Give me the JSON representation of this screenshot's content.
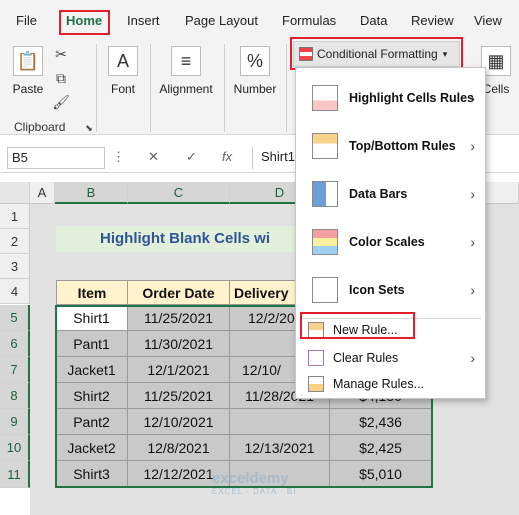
{
  "ribbon_tabs": [
    "File",
    "Home",
    "Insert",
    "Page Layout",
    "Formulas",
    "Data",
    "Review",
    "View"
  ],
  "ribbon": {
    "paste_label": "Paste",
    "clipboard_label": "Clipboard",
    "font_label": "Font",
    "alignment_label": "Alignment",
    "number_label": "Number",
    "cells_label": "Cells",
    "conditional_formatting_label": "Conditional Formatting"
  },
  "formula_bar": {
    "name_box": "B5",
    "fx": "fx",
    "formula_value": "Shirt1"
  },
  "columns": [
    "A",
    "B",
    "C",
    "D"
  ],
  "rows": [
    "1",
    "2",
    "3",
    "4",
    "5",
    "6",
    "7",
    "8",
    "9",
    "10",
    "11"
  ],
  "sheet": {
    "title": "Highlight Blank Cells wi",
    "headers": [
      "Item",
      "Order Date",
      "Delivery"
    ],
    "rows": [
      {
        "item": "Shirt1",
        "order": "11/25/2021",
        "delivery": "12/2/20",
        "amount": ""
      },
      {
        "item": "Pant1",
        "order": "11/30/2021",
        "delivery": "",
        "amount": ""
      },
      {
        "item": "Jacket1",
        "order": "12/1/2021",
        "delivery": "12/10/",
        "amount": ""
      },
      {
        "item": "Shirt2",
        "order": "11/25/2021",
        "delivery": "11/28/2021",
        "amount": "$4,150"
      },
      {
        "item": "Pant2",
        "order": "12/10/2021",
        "delivery": "",
        "amount": "$2,436"
      },
      {
        "item": "Jacket2",
        "order": "12/8/2021",
        "delivery": "12/13/2021",
        "amount": "$2,425"
      },
      {
        "item": "Shirt3",
        "order": "12/12/2021",
        "delivery": "",
        "amount": "$5,010"
      }
    ]
  },
  "menu": {
    "items": [
      {
        "label": "Highlight Cells Rules",
        "icon": "highlight-cells-icon"
      },
      {
        "label": "Top/Bottom Rules",
        "icon": "top-bottom-icon"
      },
      {
        "label": "Data Bars",
        "icon": "data-bars-icon"
      },
      {
        "label": "Color Scales",
        "icon": "color-scales-icon"
      },
      {
        "label": "Icon Sets",
        "icon": "icon-sets-icon"
      }
    ],
    "new_rule": "New Rule...",
    "clear_rules": "Clear Rules",
    "manage_rules": "Manage Rules..."
  },
  "watermark": {
    "name": "exceldemy",
    "tagline": "EXCEL · DATA · BI"
  },
  "colors": {
    "accent": "#217346",
    "highlight_box": "#e0202a",
    "header_fill": "#fff2cc",
    "title_fill": "#e2efda",
    "blank_fill": "#c9c9c9"
  }
}
